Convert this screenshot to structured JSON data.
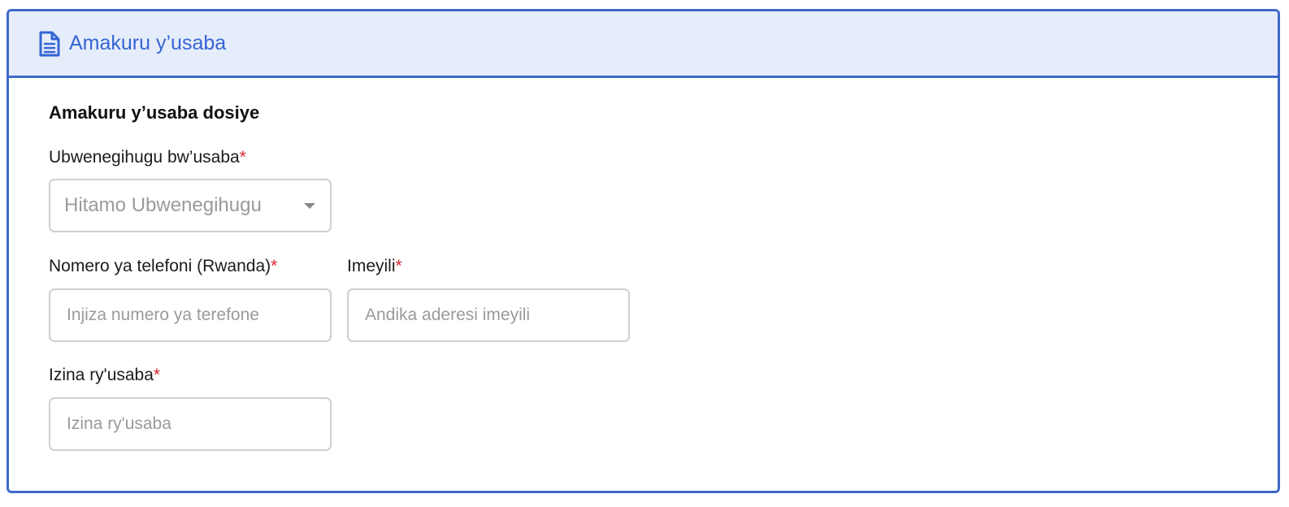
{
  "header": {
    "icon": "document-icon",
    "title": "Amakuru y’usaba"
  },
  "section": {
    "title": "Amakuru y’usaba dosiye"
  },
  "fields": {
    "nationality": {
      "label": "Ubwenegihugu bw’usaba",
      "required_mark": "*",
      "placeholder": "Hitamo Ubwenegihugu"
    },
    "phone": {
      "label": "Nomero ya telefoni (Rwanda)",
      "required_mark": "*",
      "placeholder": "Injiza numero ya terefone"
    },
    "email": {
      "label": "Imeyili",
      "required_mark": "*",
      "placeholder": "Andika aderesi imeyili"
    },
    "name": {
      "label": "Izina ry'usaba",
      "required_mark": "*",
      "placeholder": "Izina ry'usaba"
    }
  },
  "colors": {
    "accent": "#3f69c9",
    "header_bg": "#e6edfa",
    "required": "#d9252f"
  }
}
